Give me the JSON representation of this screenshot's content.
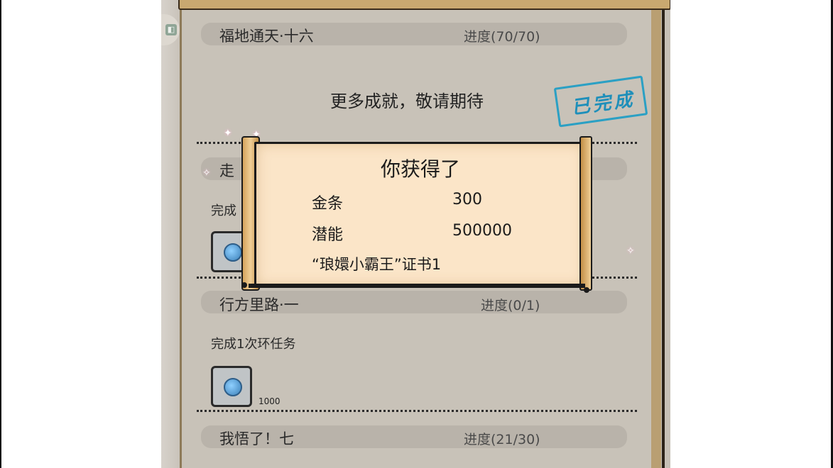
{
  "rows": [
    {
      "title": "福地通天·十六",
      "progress": "进度(70/70)"
    },
    {
      "title": "走",
      "desc": "完成",
      "reward_count": ""
    },
    {
      "title": "行方里路·一",
      "progress": "进度(0/1)",
      "desc": "完成1次环任务",
      "reward_count": "1000"
    },
    {
      "title": "我悟了！七",
      "progress": "进度(21/30)"
    }
  ],
  "center_message": "更多成就，敬请期待",
  "stamp_text": "已完成",
  "corner_icon": "mini-map-icon",
  "popup": {
    "title": "你获得了",
    "rewards": [
      {
        "name": "金条",
        "value": "300"
      },
      {
        "name": "潜能",
        "value": "500000"
      }
    ],
    "note": "“琅嬛小霸王”证书1"
  },
  "colors": {
    "stamp": "#1e8fba",
    "popup_bg": "#fbe5c8",
    "scroll_wood": "#c9a870"
  }
}
